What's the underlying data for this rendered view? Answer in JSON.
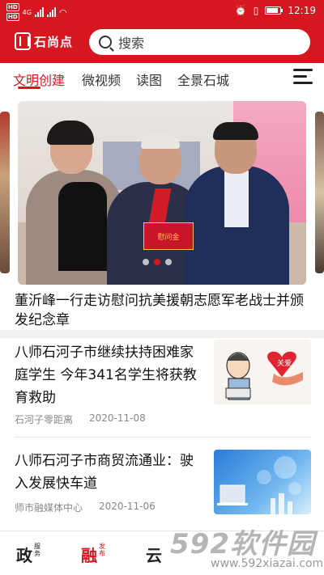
{
  "status_bar": {
    "time": "12:19",
    "network": "4G",
    "hd1": "HD",
    "hd2": "HD",
    "alarm_icon": "alarm-icon",
    "vibrate_icon": "vibrate-icon"
  },
  "header": {
    "app_name": "石尚点",
    "search_placeholder": "搜索",
    "brand_color": "#d7171f"
  },
  "tabs": [
    {
      "label": "文明创建",
      "active": true
    },
    {
      "label": "微视频",
      "active": false
    },
    {
      "label": "读图",
      "active": false
    },
    {
      "label": "全景石城",
      "active": false
    }
  ],
  "carousel": {
    "card_text": "慰问金",
    "headline": "董沂峰一行走访慰问抗美援朝志愿军老战士并颁发纪念章",
    "pages": 3,
    "current_page": 2
  },
  "news": [
    {
      "title": "八师石河子市继续扶持困难家庭学生 今年341名学生将获教育救助",
      "source": "石河子零距离",
      "date": "2020-11-08",
      "thumb_text": "关爱"
    },
    {
      "title": "八师石河子市商贸流通业：驶入发展快车道",
      "source": "师市融媒体中心",
      "date": "2020-11-06"
    }
  ],
  "bottom_nav": [
    {
      "main": "政",
      "sub": "服务",
      "active": false
    },
    {
      "main": "融",
      "sub": "发布",
      "active": true
    },
    {
      "main": "云",
      "sub": "",
      "active": false
    }
  ],
  "watermark": {
    "big": "592软件园",
    "url": "www.592xiazai.com"
  }
}
